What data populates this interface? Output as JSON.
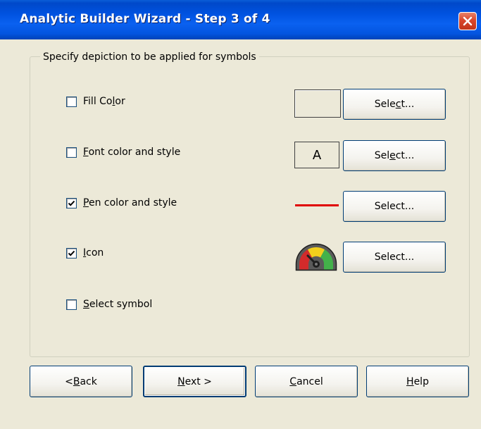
{
  "window": {
    "title": "Analytic Builder Wizard - Step 3 of 4"
  },
  "group": {
    "legend": "Specify depiction to be applied for symbols"
  },
  "options": [
    {
      "label_pre": "Fill Co",
      "label_mnemonic": "l",
      "label_post": "or",
      "checked": false
    },
    {
      "label_pre": "",
      "label_mnemonic": "F",
      "label_post": "ont color and style",
      "checked": false
    },
    {
      "label_pre": "",
      "label_mnemonic": "P",
      "label_post": "en color and style",
      "checked": true
    },
    {
      "label_pre": "",
      "label_mnemonic": "I",
      "label_post": "con",
      "checked": true
    },
    {
      "label_pre": "",
      "label_mnemonic": "S",
      "label_post": "elect symbol",
      "checked": false
    }
  ],
  "previews": {
    "font_sample": "A",
    "pen_color": "#e00000"
  },
  "select_buttons": [
    {
      "pre": "Sele",
      "mnemonic": "c",
      "post": "t..."
    },
    {
      "pre": "Sel",
      "mnemonic": "e",
      "post": "ct..."
    },
    {
      "pre": "Select...",
      "mnemonic": "",
      "post": ""
    },
    {
      "pre": "Select...",
      "mnemonic": "",
      "post": ""
    }
  ],
  "footer": {
    "back": {
      "pre": "< ",
      "mnemonic": "B",
      "post": "ack"
    },
    "next": {
      "pre": "",
      "mnemonic": "N",
      "post": "ext >"
    },
    "cancel": {
      "pre": "",
      "mnemonic": "C",
      "post": "ancel"
    },
    "help": {
      "pre": "",
      "mnemonic": "H",
      "post": "elp"
    }
  }
}
